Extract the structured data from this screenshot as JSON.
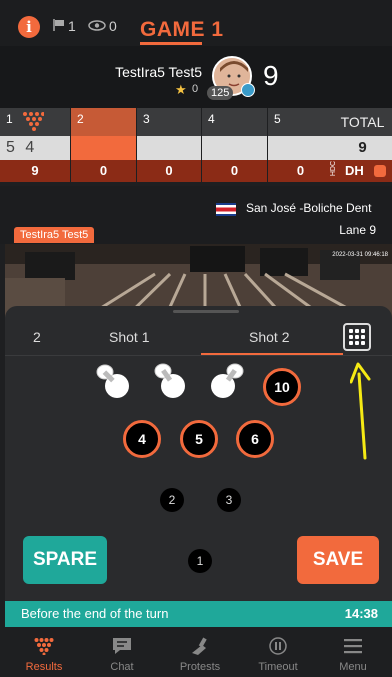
{
  "topbar": {
    "flag_count": "1",
    "eye_count": "0",
    "game_label": "GAME 1"
  },
  "player": {
    "name": "TestIra5 Test5",
    "stars": "0",
    "badge": "125",
    "score": "9"
  },
  "scoreboard": {
    "frames": [
      {
        "number": "1",
        "shots": "5 4",
        "total": "9"
      },
      {
        "number": "2",
        "shots": "",
        "total": "0"
      },
      {
        "number": "3",
        "shots": "",
        "total": "0"
      },
      {
        "number": "4",
        "shots": "",
        "total": "0"
      },
      {
        "number": "5",
        "shots": "",
        "total": "0"
      }
    ],
    "total_label": "TOTAL",
    "total_value": "9",
    "hdc_label": "HDC",
    "dh_label": "DH"
  },
  "venue": {
    "name": "San José -Boliche Dent",
    "lane": "Lane 9",
    "player_tag": "TestIra5 Test5"
  },
  "video": {
    "timestamp": "2022-03-31 09:46:18"
  },
  "shot_panel": {
    "frame_number": "2",
    "shot1_label": "Shot 1",
    "shot2_label": "Shot 2",
    "standing_pins": [
      "10",
      "4",
      "5",
      "6"
    ],
    "other_pins": [
      "2",
      "3",
      "1"
    ]
  },
  "actions": {
    "spare_label": "SPARE",
    "save_label": "SAVE"
  },
  "turn": {
    "text": "Before the end of the turn",
    "time": "14:38"
  },
  "nav": {
    "items": [
      {
        "label": "Results",
        "icon": "pins-icon"
      },
      {
        "label": "Chat",
        "icon": "chat-icon"
      },
      {
        "label": "Protests",
        "icon": "protest-icon"
      },
      {
        "label": "Timeout",
        "icon": "pause-icon"
      },
      {
        "label": "Menu",
        "icon": "menu-icon"
      }
    ]
  },
  "colors": {
    "accent": "#f26a3d",
    "teal": "#1fa89a",
    "highlight_arrow": "#f5ea14"
  }
}
